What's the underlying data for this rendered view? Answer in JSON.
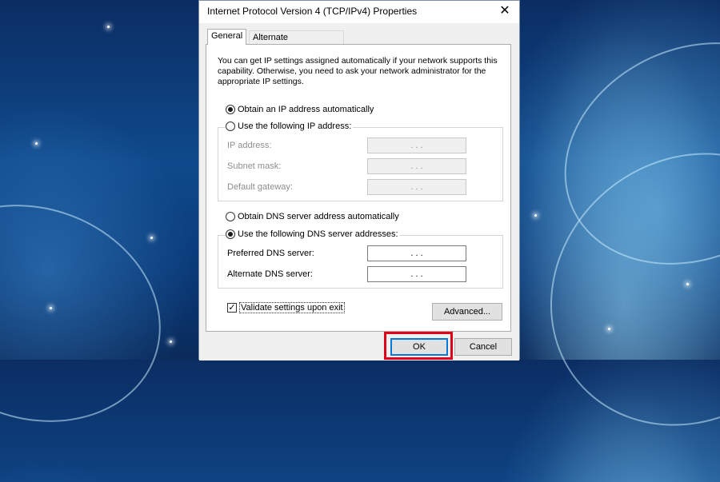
{
  "dialog": {
    "title": "Internet Protocol Version 4 (TCP/IPv4) Properties",
    "close_glyph": "✕"
  },
  "tabs": [
    {
      "label": "General",
      "active": true
    },
    {
      "label": "Alternate Configuration",
      "active": false
    }
  ],
  "intro_text": "You can get IP settings assigned automatically if your network supports this capability. Otherwise, you need to ask your network administrator for the appropriate IP settings.",
  "ip_section": {
    "auto_label": "Obtain an IP address automatically",
    "auto_selected": true,
    "manual_label": "Use the following IP address:",
    "manual_selected": false,
    "fields": [
      {
        "label": "IP address:",
        "value": ".  .  .",
        "enabled": false
      },
      {
        "label": "Subnet mask:",
        "value": ".  .  .",
        "enabled": false
      },
      {
        "label": "Default gateway:",
        "value": ".  .  .",
        "enabled": false
      }
    ]
  },
  "dns_section": {
    "auto_label": "Obtain DNS server address automatically",
    "auto_selected": false,
    "manual_label": "Use the following DNS server addresses:",
    "manual_selected": true,
    "fields": [
      {
        "label": "Preferred DNS server:",
        "value": ".  .  .",
        "enabled": true
      },
      {
        "label": "Alternate DNS server:",
        "value": ".  .  .",
        "enabled": true
      }
    ]
  },
  "validate": {
    "label": "Validate settings upon exit",
    "checked": true,
    "check_glyph": "✓"
  },
  "buttons": {
    "advanced": "Advanced...",
    "ok": "OK",
    "cancel": "Cancel"
  },
  "colors": {
    "highlight": "#e0001b",
    "focus_blue": "#0078d7"
  }
}
